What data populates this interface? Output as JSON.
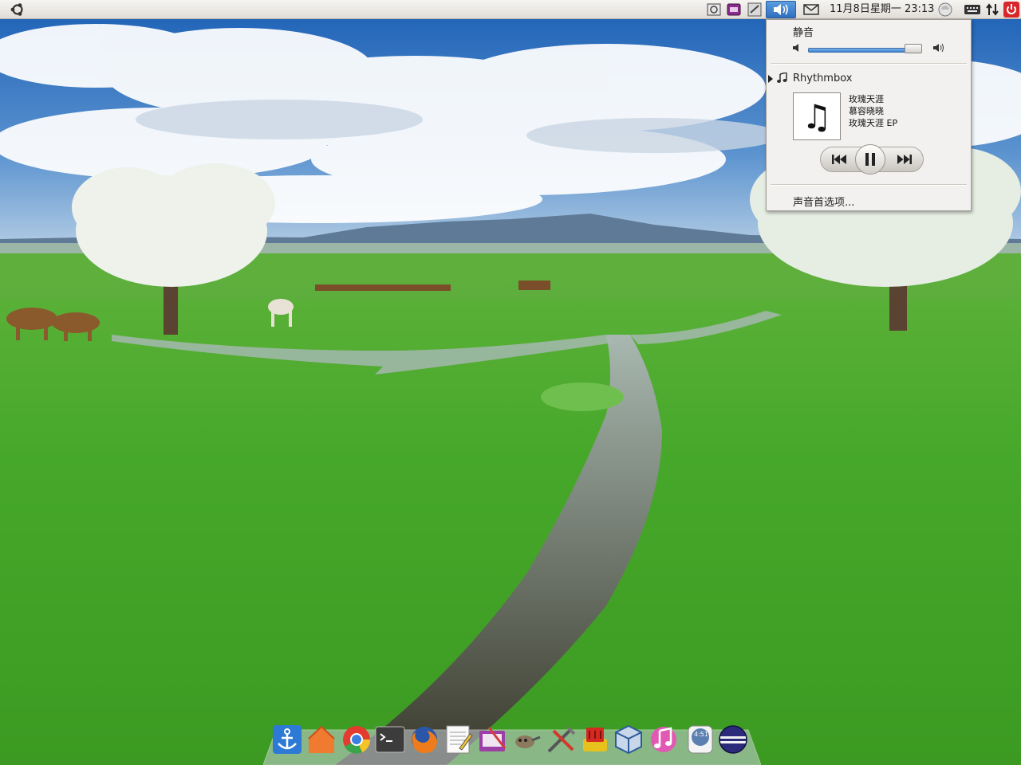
{
  "top_panel": {
    "clock": "11月8日星期一 23:13",
    "icons": [
      "ubuntu-logo-icon",
      "screenshot-icon",
      "media-player-icon",
      "display-icon",
      "volume-icon",
      "mail-icon",
      "power-status-icon",
      "keyboard-icon",
      "network-icon",
      "shutdown-icon"
    ]
  },
  "sound_menu": {
    "mute_label": "静音",
    "volume_level_percent": 94,
    "player_name": "Rhythmbox",
    "track": {
      "title": "玫瑰天涯",
      "artist": "慕容晓晓",
      "album": "玫瑰天涯 EP"
    },
    "playback_state": "playing",
    "preferences_label": "声音首选项..."
  },
  "dock": {
    "items": [
      "docky-anchor-icon",
      "home-folder-icon",
      "chrome-icon",
      "terminal-icon",
      "firefox-icon",
      "text-editor-icon",
      "system-settings-icon",
      "gimp-icon",
      "tools-icon",
      "package-manager-icon",
      "virtualbox-icon",
      "music-player-icon",
      "clock-icon",
      "eclipse-icon"
    ],
    "clock_icon_text": "4:51"
  },
  "colors": {
    "panel_bg": "#e8e6e1",
    "menu_bg": "#f2f1f0",
    "highlight": "#3b7fd0"
  }
}
